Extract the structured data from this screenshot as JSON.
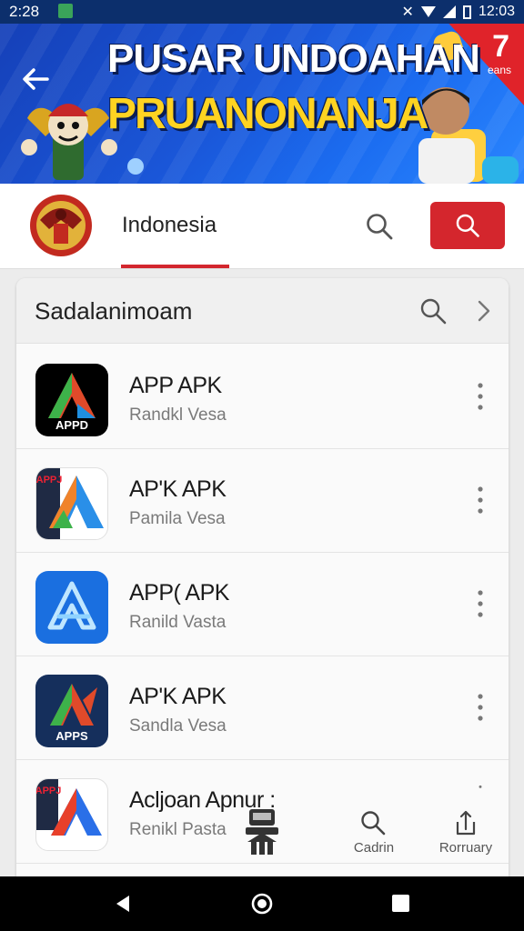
{
  "status_bar": {
    "time": "2:28",
    "right_time": "12:03"
  },
  "banner": {
    "title_line1": "PUSAR UNDOAHAN",
    "title_line2": "PRUANONANJA",
    "badge_number": "7",
    "badge_sub": "eans"
  },
  "tab_bar": {
    "tab_label": "Indonesia"
  },
  "panel": {
    "title": "Sadalanimoam",
    "apps": [
      {
        "name": "APP APK",
        "subtitle": "Randkl Vesa",
        "icon_text": "APPD",
        "icon_bg": "#000000"
      },
      {
        "name": "AP'K APK",
        "subtitle": "Pamila Vesa",
        "icon_text": "APPJ",
        "icon_bg": "#ffffff"
      },
      {
        "name": "APP( APK",
        "subtitle": "Ranild Vasta",
        "icon_text": "",
        "icon_bg": "#1a6fe0"
      },
      {
        "name": "AP'K APK",
        "subtitle": "Sandla Vesa",
        "icon_text": "APPS",
        "icon_bg": "#152f5c"
      },
      {
        "name": "Acljoan Apnur :",
        "subtitle": "Renikl Pasta",
        "icon_text": "APPJ",
        "icon_bg": "#ffffff"
      }
    ]
  },
  "bottom_nav": {
    "search_label": "Cadrin",
    "share_label": "Rorruary"
  },
  "colors": {
    "accent_red": "#d4262d",
    "banner_blue": "#1a56d8",
    "status_bar": "#0c2f6c",
    "title_yellow": "#ffd321"
  },
  "icons": [
    "back-arrow-icon",
    "search-icon",
    "chevron-right-icon",
    "more-vertical-icon",
    "home-icon",
    "share-icon",
    "wifi-icon",
    "battery-icon"
  ]
}
